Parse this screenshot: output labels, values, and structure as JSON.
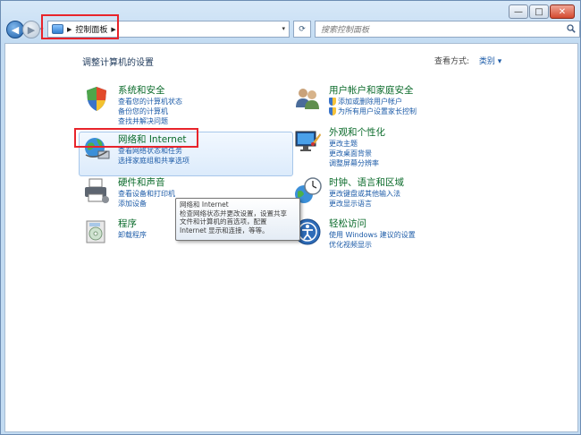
{
  "window": {
    "minimize": "—",
    "maximize": "□",
    "close": "✕"
  },
  "nav": {
    "breadcrumb": "控制面板",
    "search_placeholder": "搜索控制面板"
  },
  "main": {
    "heading": "调整计算机的设置",
    "view_by_label": "查看方式:",
    "view_by_value": "类别 ▾"
  },
  "categories": {
    "system": {
      "title": "系统和安全",
      "links": [
        "查看您的计算机状态",
        "备份您的计算机",
        "查找并解决问题"
      ]
    },
    "network": {
      "title": "网络和 Internet",
      "links": [
        "查看网络状态和任务",
        "选择家庭组和共享选项"
      ]
    },
    "hardware": {
      "title": "硬件和声音",
      "links": [
        "查看设备和打印机",
        "添加设备"
      ]
    },
    "programs": {
      "title": "程序",
      "links": [
        "卸载程序"
      ]
    },
    "users": {
      "title": "用户帐户和家庭安全",
      "links": [
        "添加或删除用户帐户",
        "为所有用户设置家长控制"
      ]
    },
    "appearance": {
      "title": "外观和个性化",
      "links": [
        "更改主题",
        "更改桌面背景",
        "调整屏幕分辨率"
      ]
    },
    "clock": {
      "title": "时钟、语言和区域",
      "links": [
        "更改键盘或其他输入法",
        "更改显示语言"
      ]
    },
    "ease": {
      "title": "轻松访问",
      "links": [
        "使用 Windows 建议的设置",
        "优化视频显示"
      ]
    }
  },
  "tooltip": {
    "lines": [
      "网络和 Internet",
      "检查网络状态并更改设置，设置共享",
      "文件和计算机的首选项，配置",
      "Internet 显示和连接，等等。"
    ]
  }
}
